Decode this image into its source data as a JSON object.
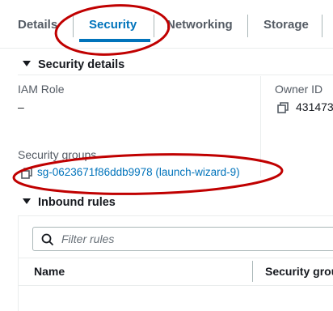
{
  "tabs": [
    {
      "label": "Details",
      "active": false
    },
    {
      "label": "Security",
      "active": true
    },
    {
      "label": "Networking",
      "active": false
    },
    {
      "label": "Storage",
      "active": false
    }
  ],
  "security_details": {
    "header": "Security details",
    "iam_role": {
      "label": "IAM Role",
      "value": "–"
    },
    "owner_id": {
      "label": "Owner ID",
      "value": "431473"
    },
    "security_groups": {
      "label": "Security groups",
      "link": "sg-0623671f86ddb9978 (launch-wizard-9)"
    }
  },
  "inbound_rules": {
    "header": "Inbound rules",
    "filter": {
      "placeholder": "Filter rules"
    },
    "columns": [
      "Name",
      "Security grou"
    ]
  },
  "colors": {
    "accent": "#0073bb",
    "annotation": "#c00000",
    "text": "#16191f",
    "muted": "#545b64"
  }
}
